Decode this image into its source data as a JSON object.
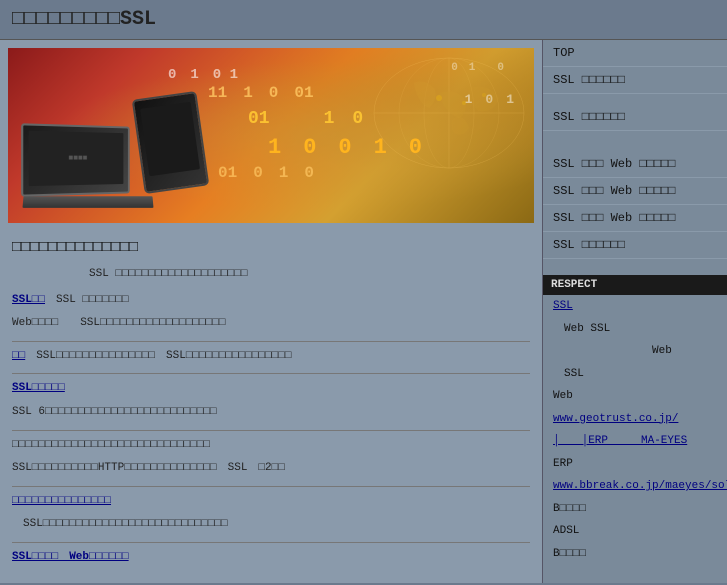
{
  "header": {
    "title": "□□□□□□□□□SSL"
  },
  "hero": {
    "binary_lines": [
      "01 0 1101 01 0",
      "0101 0 100 1 01",
      "1 0 1 0 11 010",
      "010 1 0101 0 1"
    ]
  },
  "nav": {
    "items": [
      {
        "label": "TOP",
        "id": "top"
      },
      {
        "label": "SSL □□□□□□",
        "id": "ssl1"
      },
      {
        "label": "",
        "id": "spacer1"
      },
      {
        "label": "SSL □□□□□□",
        "id": "ssl2"
      },
      {
        "label": "",
        "id": "spacer2"
      },
      {
        "label": "SSL □□□ Web □□□□□",
        "id": "ssl-web1"
      },
      {
        "label": "SSL □□□ Web □□□□□",
        "id": "ssl-web2"
      },
      {
        "label": "SSL □□□ Web □□□□□",
        "id": "ssl-web3"
      },
      {
        "label": "SSL □□□□□□",
        "id": "ssl3"
      }
    ]
  },
  "sidebar_section": {
    "header": "RESPECT",
    "items": [
      {
        "label": "SSL",
        "link": true
      },
      {
        "label": "　Web  SSL",
        "link": false
      },
      {
        "label": "　　　　　　　　　Web",
        "link": false
      },
      {
        "label": "　SSL",
        "link": false
      },
      {
        "label": "Web",
        "link": false
      },
      {
        "label": "www.geotrust.co.jp/",
        "link": false
      },
      {
        "label": "│　　│ERP　　　MA-EYES",
        "link": false
      },
      {
        "label": "ERP",
        "link": false
      },
      {
        "label": "www.bbreak.co.jp/maeyes/solution/hanbai",
        "link": false
      },
      {
        "label": "B□□□□",
        "link": false
      },
      {
        "label": "ADSL",
        "link": false
      },
      {
        "label": "B□□□□",
        "link": false
      }
    ]
  },
  "content": {
    "subtitle": "□□□□□□□□□□□□□□",
    "intro": "　　　　　　　SSL □□□□□□□□□□□□□□□□□□□□",
    "line1": "SSL □□□□□□□　　　　　　　　　　　　　",
    "line1b": "Web□□□□　　SSL□□□□□□□□□□□□□□□□□□□",
    "line2_label": "□□□□□□□□□",
    "line2": "SSL□□□□□□□□□□□□□□□　SSL□□□□□□□□□□□□□□□□",
    "line3_label": "SSL□□□□□□□",
    "line3": "SSL 6□□□□□□□□□□□□□□□□□□□□□□□□□□",
    "line4": "□□□□□□□□□□□□□□□□□□□□□□□□□□□□□□",
    "line4b": "SSL□□□□□□□□□□HTTP□□□□□□□□□□□□□□　SSL　□2□□",
    "line5_label": "□□□□□□□□□□□□",
    "line5": "　SSL□□□□□□□□□□□□□□□□□□□□□□□□□□□□",
    "line6_label": "SSL□□□□　Web□□□□□□"
  }
}
